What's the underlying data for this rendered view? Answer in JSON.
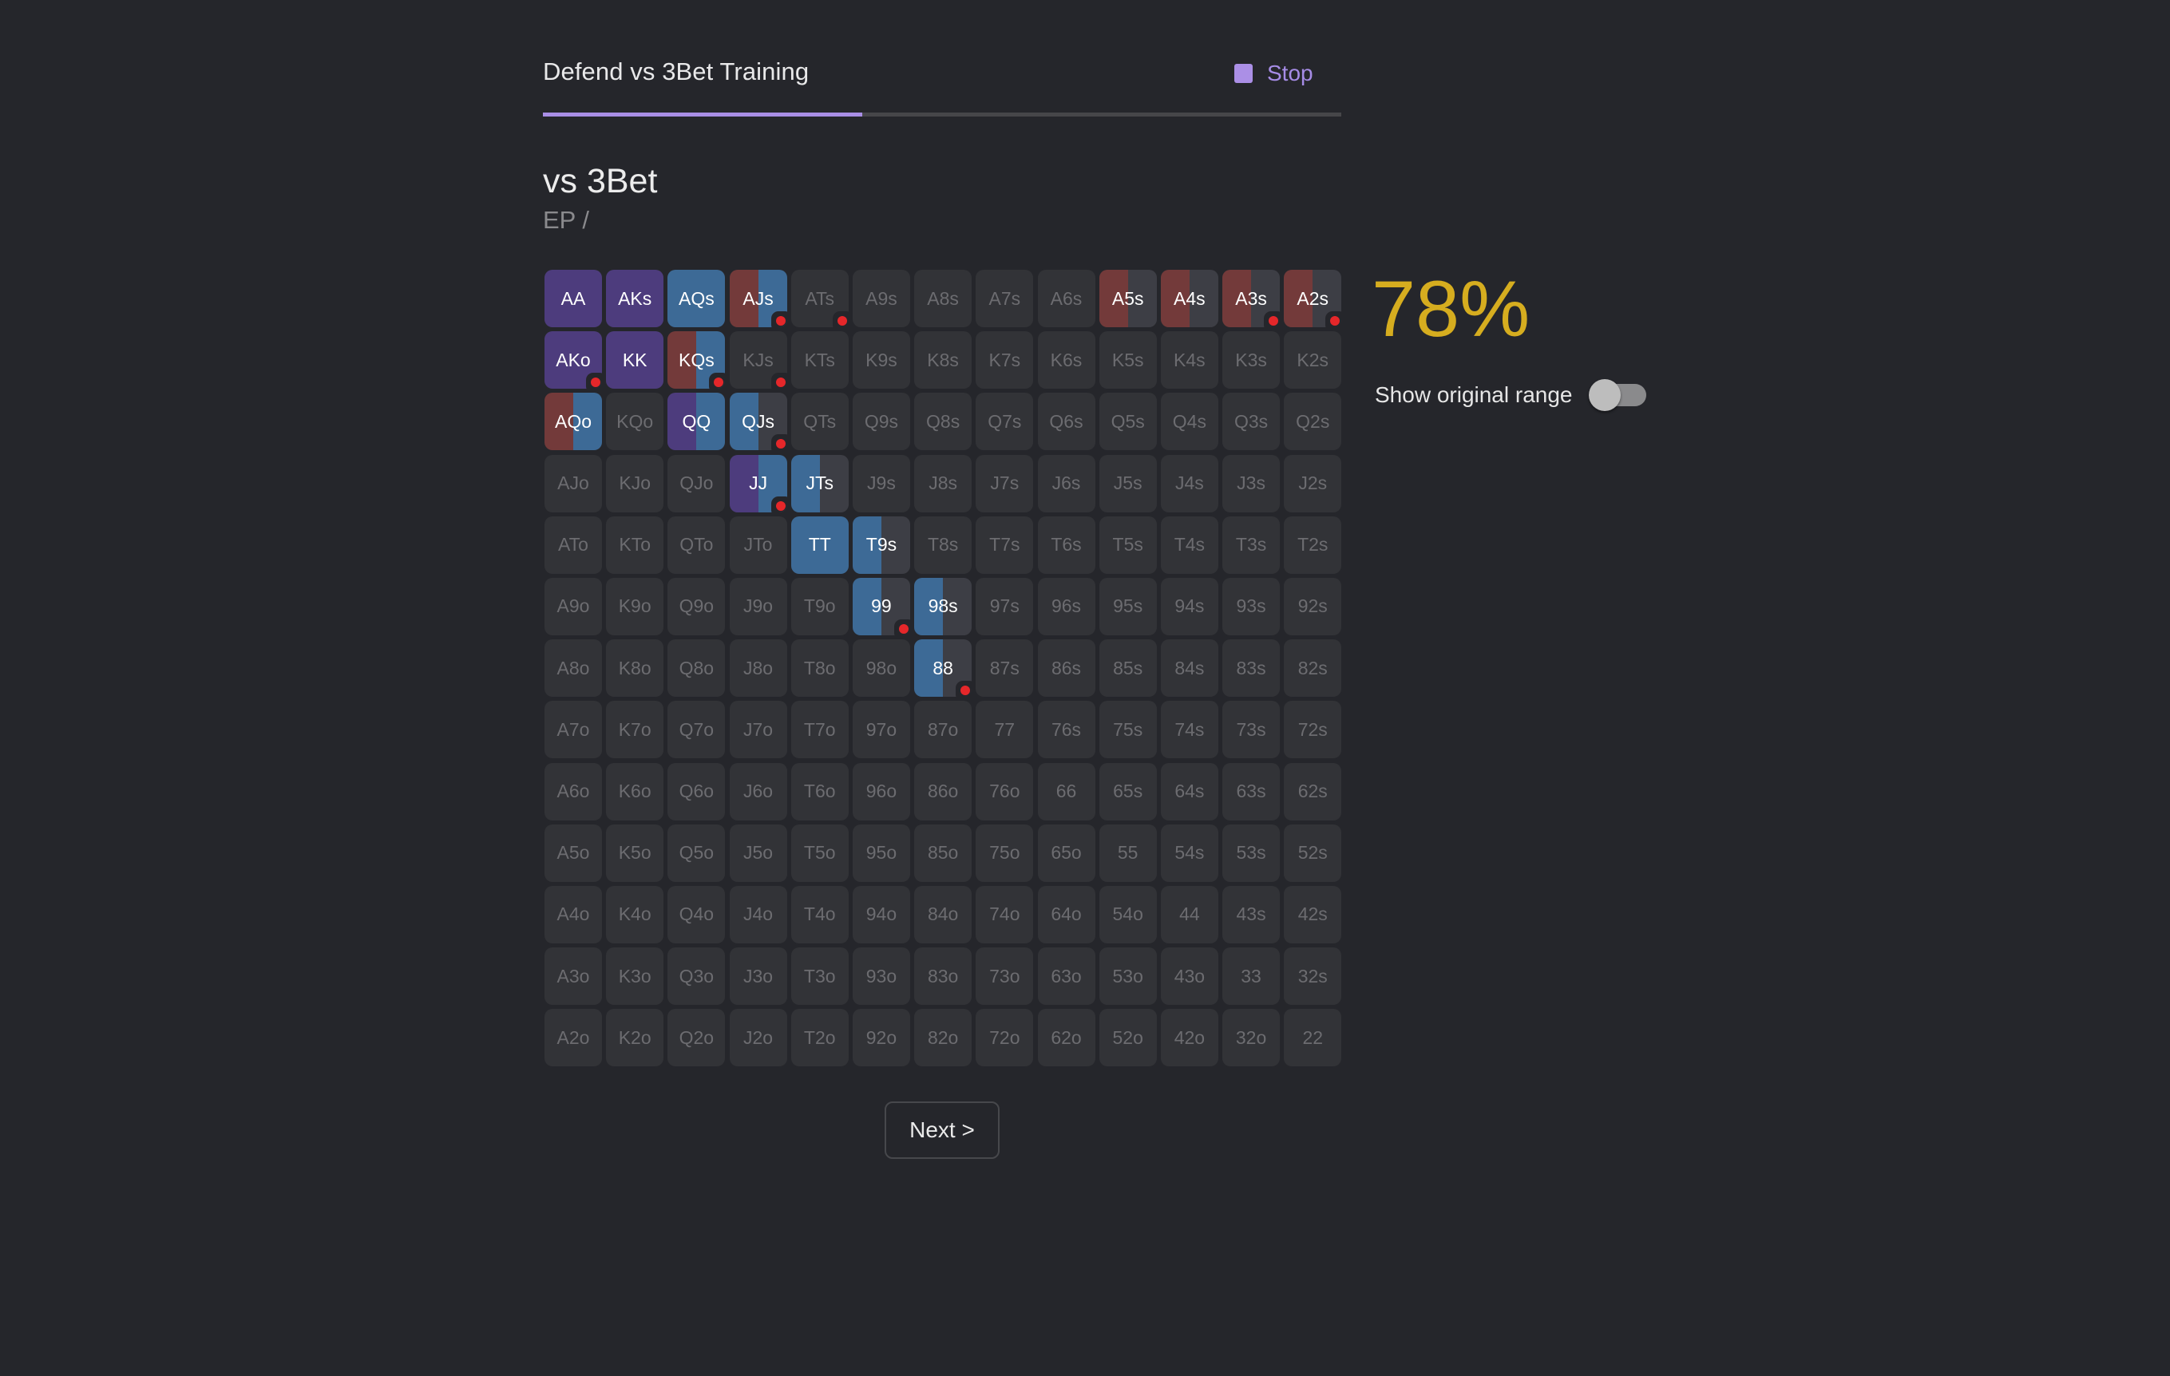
{
  "header": {
    "title": "Defend vs 3Bet Training",
    "stop_icon": "stop-square-icon",
    "stop_label": "Stop",
    "progress_fraction": 0.4
  },
  "section": {
    "title": "vs 3Bet",
    "subtitle": "EP /"
  },
  "colors": {
    "background": "#25262b",
    "accent": "#a98ee6",
    "action_purple": "#4d3c7d",
    "action_blue": "#3d6a96",
    "action_red": "#733a3a",
    "remainder_gray": "#3d3e45",
    "empty_cell": "#323337",
    "error_dot": "#e5272a",
    "score": "#d6ad1f"
  },
  "legend_note": "Cell segments show action frequencies; red dot marks a mistake",
  "grid": {
    "rows": [
      [
        "AA",
        "AKs",
        "AQs",
        "AJs",
        "ATs",
        "A9s",
        "A8s",
        "A7s",
        "A6s",
        "A5s",
        "A4s",
        "A3s",
        "A2s"
      ],
      [
        "AKo",
        "KK",
        "KQs",
        "KJs",
        "KTs",
        "K9s",
        "K8s",
        "K7s",
        "K6s",
        "K5s",
        "K4s",
        "K3s",
        "K2s"
      ],
      [
        "AQo",
        "KQo",
        "QQ",
        "QJs",
        "QTs",
        "Q9s",
        "Q8s",
        "Q7s",
        "Q6s",
        "Q5s",
        "Q4s",
        "Q3s",
        "Q2s"
      ],
      [
        "AJo",
        "KJo",
        "QJo",
        "JJ",
        "JTs",
        "J9s",
        "J8s",
        "J7s",
        "J6s",
        "J5s",
        "J4s",
        "J3s",
        "J2s"
      ],
      [
        "ATo",
        "KTo",
        "QTo",
        "JTo",
        "TT",
        "T9s",
        "T8s",
        "T7s",
        "T6s",
        "T5s",
        "T4s",
        "T3s",
        "T2s"
      ],
      [
        "A9o",
        "K9o",
        "Q9o",
        "J9o",
        "T9o",
        "99",
        "98s",
        "97s",
        "96s",
        "95s",
        "94s",
        "93s",
        "92s"
      ],
      [
        "A8o",
        "K8o",
        "Q8o",
        "J8o",
        "T8o",
        "98o",
        "88",
        "87s",
        "86s",
        "85s",
        "84s",
        "83s",
        "82s"
      ],
      [
        "A7o",
        "K7o",
        "Q7o",
        "J7o",
        "T7o",
        "97o",
        "87o",
        "77",
        "76s",
        "75s",
        "74s",
        "73s",
        "72s"
      ],
      [
        "A6o",
        "K6o",
        "Q6o",
        "J6o",
        "T6o",
        "96o",
        "86o",
        "76o",
        "66",
        "65s",
        "64s",
        "63s",
        "62s"
      ],
      [
        "A5o",
        "K5o",
        "Q5o",
        "J5o",
        "T5o",
        "95o",
        "85o",
        "75o",
        "65o",
        "55",
        "54s",
        "53s",
        "52s"
      ],
      [
        "A4o",
        "K4o",
        "Q4o",
        "J4o",
        "T4o",
        "94o",
        "84o",
        "74o",
        "64o",
        "54o",
        "44",
        "43s",
        "42s"
      ],
      [
        "A3o",
        "K3o",
        "Q3o",
        "J3o",
        "T3o",
        "93o",
        "83o",
        "73o",
        "63o",
        "53o",
        "43o",
        "33",
        "32s"
      ],
      [
        "A2o",
        "K2o",
        "Q2o",
        "J2o",
        "T2o",
        "92o",
        "82o",
        "72o",
        "62o",
        "52o",
        "42o",
        "32o",
        "22"
      ]
    ],
    "hands": {
      "AA": {
        "segments": [
          {
            "action": "purple",
            "pct": 100
          }
        ]
      },
      "AKs": {
        "segments": [
          {
            "action": "purple",
            "pct": 100
          }
        ]
      },
      "AQs": {
        "segments": [
          {
            "action": "blue",
            "pct": 100
          }
        ]
      },
      "AJs": {
        "segments": [
          {
            "action": "red",
            "pct": 50
          },
          {
            "action": "blue",
            "pct": 50
          }
        ],
        "mistake": true
      },
      "ATs": {
        "segments": [],
        "mistake": true
      },
      "A5s": {
        "segments": [
          {
            "action": "red",
            "pct": 50
          },
          {
            "action": "gray",
            "pct": 50
          }
        ]
      },
      "A4s": {
        "segments": [
          {
            "action": "red",
            "pct": 50
          },
          {
            "action": "gray",
            "pct": 50
          }
        ]
      },
      "A3s": {
        "segments": [
          {
            "action": "red",
            "pct": 50
          },
          {
            "action": "gray",
            "pct": 50
          }
        ],
        "mistake": true
      },
      "A2s": {
        "segments": [
          {
            "action": "red",
            "pct": 50
          },
          {
            "action": "gray",
            "pct": 50
          }
        ],
        "mistake": true
      },
      "AKo": {
        "segments": [
          {
            "action": "purple",
            "pct": 100
          }
        ],
        "mistake": true
      },
      "KK": {
        "segments": [
          {
            "action": "purple",
            "pct": 100
          }
        ]
      },
      "KQs": {
        "segments": [
          {
            "action": "red",
            "pct": 50
          },
          {
            "action": "blue",
            "pct": 50
          }
        ],
        "mistake": true
      },
      "KJs": {
        "segments": [],
        "mistake": true
      },
      "AQo": {
        "segments": [
          {
            "action": "red",
            "pct": 50
          },
          {
            "action": "blue",
            "pct": 50
          }
        ]
      },
      "QQ": {
        "segments": [
          {
            "action": "purple",
            "pct": 50
          },
          {
            "action": "blue",
            "pct": 50
          }
        ]
      },
      "QJs": {
        "segments": [
          {
            "action": "blue",
            "pct": 50
          },
          {
            "action": "gray",
            "pct": 50
          }
        ],
        "mistake": true
      },
      "JJ": {
        "segments": [
          {
            "action": "purple",
            "pct": 50
          },
          {
            "action": "blue",
            "pct": 50
          }
        ],
        "mistake": true
      },
      "JTs": {
        "segments": [
          {
            "action": "blue",
            "pct": 50
          },
          {
            "action": "gray",
            "pct": 50
          }
        ]
      },
      "TT": {
        "segments": [
          {
            "action": "blue",
            "pct": 100
          }
        ]
      },
      "T9s": {
        "segments": [
          {
            "action": "blue",
            "pct": 50
          },
          {
            "action": "gray",
            "pct": 50
          }
        ]
      },
      "99": {
        "segments": [
          {
            "action": "blue",
            "pct": 50
          },
          {
            "action": "gray",
            "pct": 50
          }
        ],
        "mistake": true
      },
      "98s": {
        "segments": [
          {
            "action": "blue",
            "pct": 50
          },
          {
            "action": "gray",
            "pct": 50
          }
        ]
      },
      "88": {
        "segments": [
          {
            "action": "blue",
            "pct": 50
          },
          {
            "action": "gray",
            "pct": 50
          }
        ],
        "mistake": true
      }
    }
  },
  "results": {
    "score": "78%",
    "toggle_label": "Show original range",
    "toggle_on": false
  },
  "footer": {
    "next_label": "Next >"
  }
}
